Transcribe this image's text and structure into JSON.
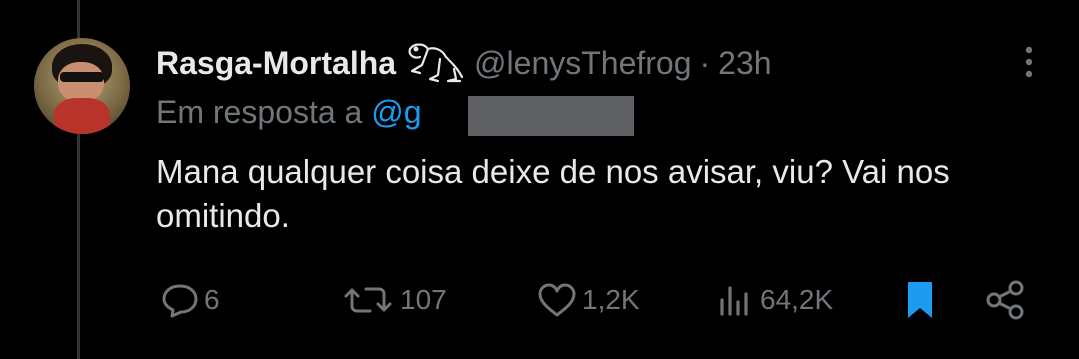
{
  "tweet": {
    "display_name": "Rasga-Mortalha",
    "handle": "@lenysThefrog",
    "separator": "·",
    "time": "23h",
    "reply_to_prefix": "Em resposta a",
    "reply_to_handle": "@g",
    "text": "Mana qualquer coisa deixe de nos avisar, viu? Vai nos omitindo."
  },
  "actions": {
    "replies": "6",
    "retweets": "107",
    "likes": "1,2K",
    "views": "64,2K"
  },
  "colors": {
    "background": "#000000",
    "text": "#e7e9ea",
    "secondary": "#71767b",
    "accent": "#1d9bf0"
  },
  "icons": [
    "reply-icon",
    "retweet-icon",
    "like-icon",
    "views-icon",
    "bookmark-icon",
    "share-icon",
    "more-icon",
    "frog-emoji-icon"
  ]
}
